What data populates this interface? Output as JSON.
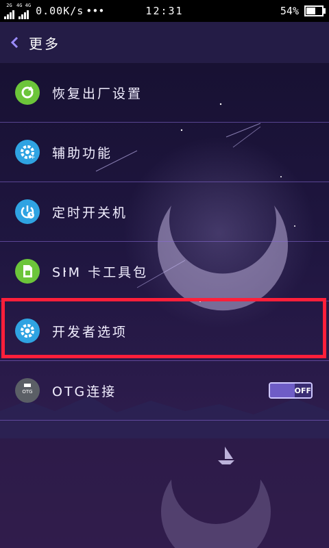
{
  "status_bar": {
    "net1": "2G",
    "net2": "4G 4G",
    "speed": "0.00K/s",
    "dots": "•••",
    "time": "12:31",
    "battery_text": "54%",
    "battery_level": 0.54
  },
  "header": {
    "title": "更多"
  },
  "menu": {
    "items": [
      {
        "label": "恢复出厂设置",
        "icon": "factory-reset-icon",
        "color": "#6cc53a"
      },
      {
        "label": "辅助功能",
        "icon": "accessibility-gear-icon",
        "color": "#2fa3e2"
      },
      {
        "label": "定时开关机",
        "icon": "scheduled-power-icon",
        "color": "#2fa3e2"
      },
      {
        "label": "SIM 卡工具包",
        "icon": "sim-card-icon",
        "color": "#6cc53a"
      },
      {
        "label": "开发者选项",
        "icon": "developer-gear-icon",
        "color": "#2fa3e2"
      },
      {
        "label": "OTG连接",
        "icon": "otg-icon",
        "color": "#5b5f66"
      }
    ]
  },
  "otg_toggle": {
    "state_label": "OFF"
  },
  "otg_icon_text": "OTG"
}
